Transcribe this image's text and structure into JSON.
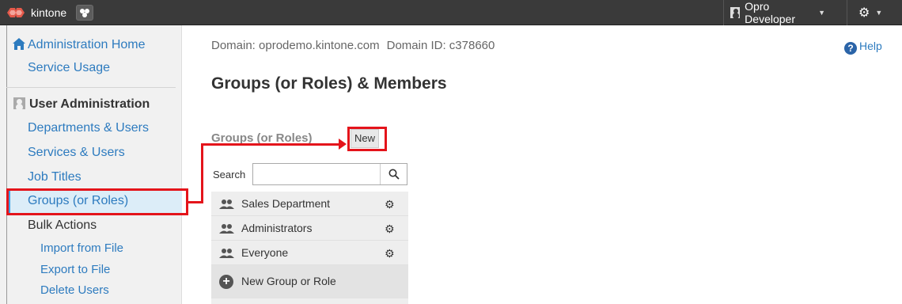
{
  "topbar": {
    "app_name": "kintone",
    "user_name": "Opro Developer",
    "colors": {
      "bar": "#3a3a3a",
      "logo": "#e55a4b"
    }
  },
  "sidebar": {
    "administration_home": "Administration Home",
    "service_usage": "Service Usage",
    "user_administration": "User Administration",
    "items": [
      {
        "label": "Departments & Users"
      },
      {
        "label": "Services & Users"
      },
      {
        "label": "Job Titles"
      },
      {
        "label": "Groups (or Roles)",
        "active": true
      },
      {
        "label": "Bulk Actions"
      }
    ],
    "bulk_actions": [
      {
        "label": "Import from File"
      },
      {
        "label": "Export to File"
      },
      {
        "label": "Delete Users"
      }
    ]
  },
  "main": {
    "domain_text": "Domain: oprodemo.kintone.com",
    "domain_id_text": "Domain ID: c378660",
    "help_label": "Help",
    "page_title": "Groups (or Roles) & Members",
    "section_title": "Groups (or Roles)",
    "new_button": "New",
    "search": {
      "label": "Search",
      "value": "",
      "placeholder": ""
    },
    "groups": [
      {
        "name": "Sales Department"
      },
      {
        "name": "Administrators"
      },
      {
        "name": "Everyone"
      }
    ],
    "new_group_label": "New Group or Role"
  },
  "colors": {
    "link": "#2d7bbf",
    "annotation": "#e4141b",
    "active_bg": "#dcedf8",
    "active_bar": "#3aa2e6"
  }
}
